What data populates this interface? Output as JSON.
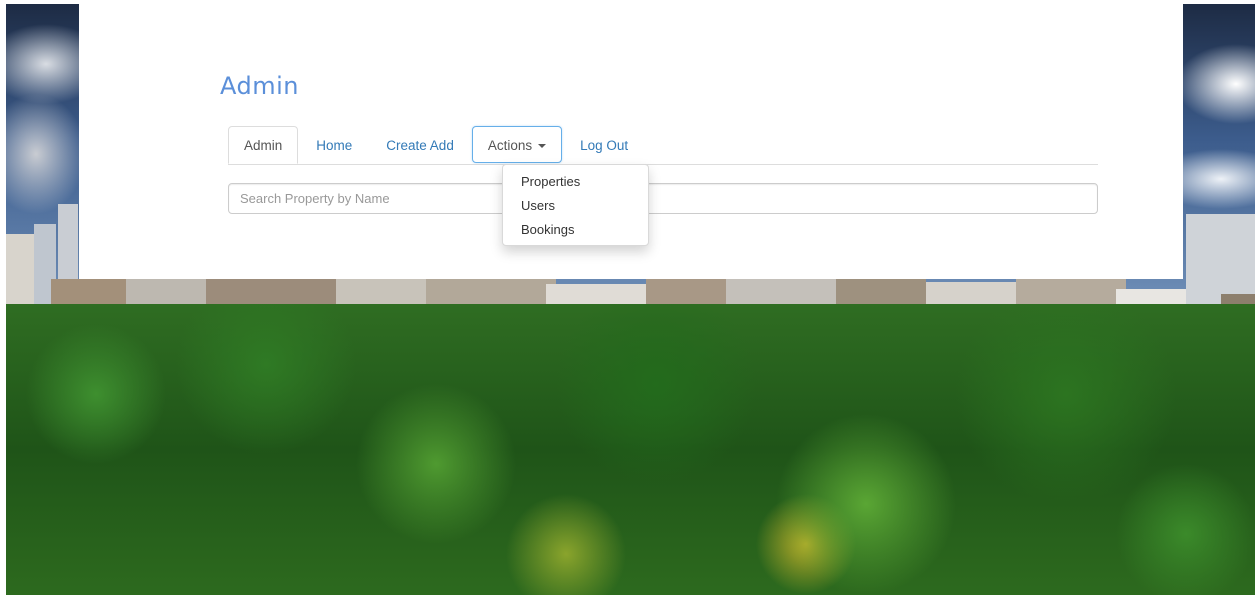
{
  "brand": "Admin",
  "nav": {
    "tabs": [
      {
        "label": "Admin"
      },
      {
        "label": "Home"
      },
      {
        "label": "Create Add"
      },
      {
        "label": "Actions"
      },
      {
        "label": "Log Out"
      }
    ],
    "active_tab": "Admin",
    "open_dropdown": "Actions"
  },
  "actions_menu": {
    "items": [
      "Properties",
      "Users",
      "Bookings"
    ]
  },
  "search": {
    "placeholder": "Search Property by Name",
    "value": ""
  },
  "colors": {
    "brand": "#5b8fd9",
    "link": "#337ab7",
    "focus_border": "#66afe9"
  }
}
